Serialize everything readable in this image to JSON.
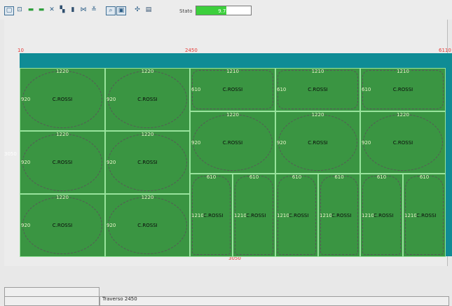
{
  "toolbar": {
    "icons": [
      "save-icon",
      "select-icon",
      "move-icon",
      "copy-icon",
      "delete-icon",
      "rotate-icon",
      "align-icon",
      "distribute-icon",
      "zoom-icon",
      "grid-icon",
      "settings-icon",
      "layers-icon"
    ],
    "stato_label": "Stato",
    "stato_value": "9.78",
    "stato_fraction": 0.55
  },
  "rulers": {
    "left": "10",
    "middle": "2450",
    "right": "6110"
  },
  "labels": {
    "left_side": "3050",
    "bottom": "3050",
    "status_traverso": "Traverso 2450"
  },
  "pieces": {
    "name": "C.ROSSI",
    "large_top": "1220",
    "large_side": "920",
    "small_top": "1210",
    "small_side": "610",
    "tall_top": "610",
    "tall_side": "1210"
  }
}
